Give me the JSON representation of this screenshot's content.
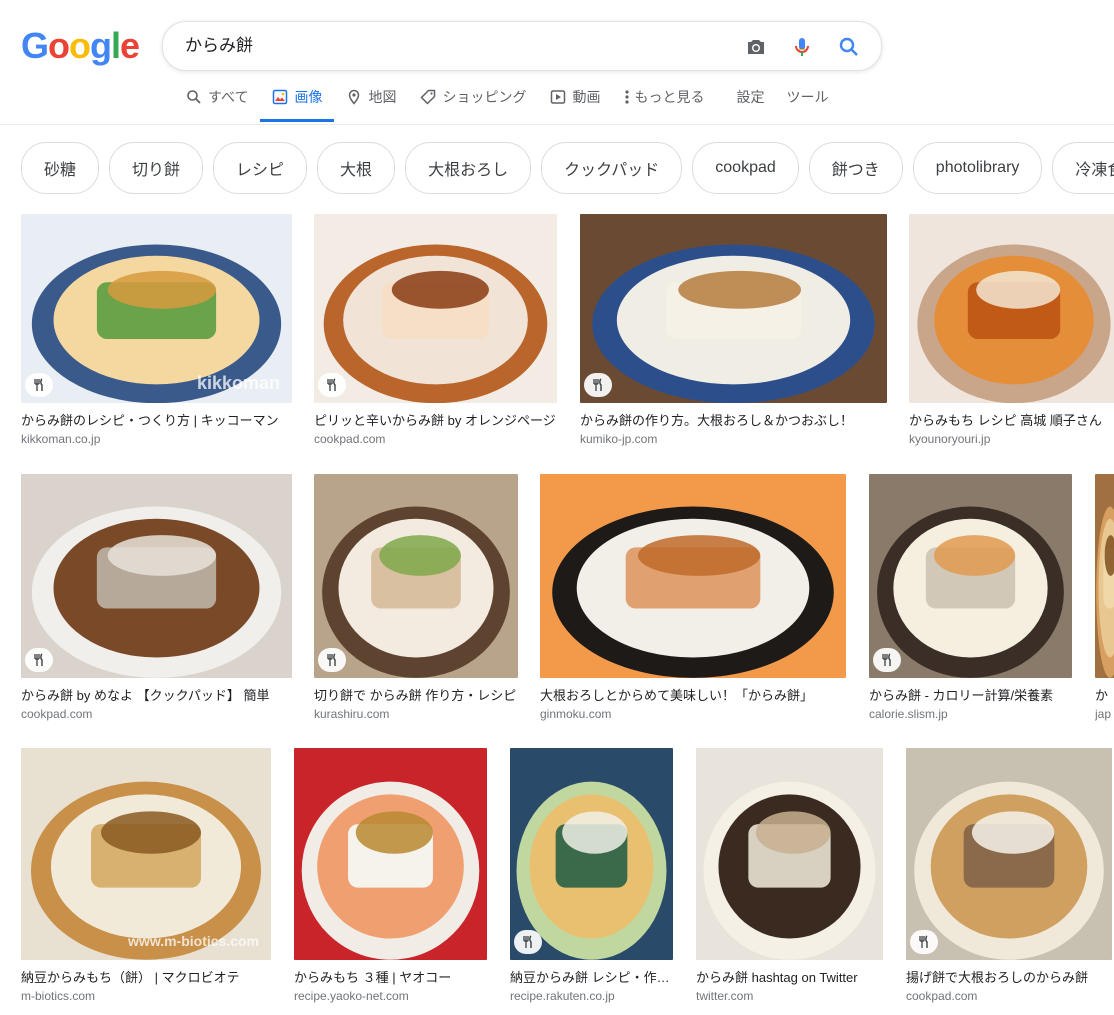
{
  "header": {
    "logo_letters": [
      {
        "ch": "G",
        "color": "#4285F4"
      },
      {
        "ch": "o",
        "color": "#EA4335"
      },
      {
        "ch": "o",
        "color": "#FBBC05"
      },
      {
        "ch": "g",
        "color": "#4285F4"
      },
      {
        "ch": "l",
        "color": "#34A853"
      },
      {
        "ch": "e",
        "color": "#EA4335"
      }
    ],
    "query": "からみ餅",
    "icons": [
      "camera-icon",
      "microphone-icon",
      "search-icon"
    ]
  },
  "tabs": [
    {
      "label": "すべて",
      "icon": "search-icon",
      "active": false
    },
    {
      "label": "画像",
      "icon": "image-icon",
      "active": true
    },
    {
      "label": "地図",
      "icon": "map-pin-icon",
      "active": false
    },
    {
      "label": "ショッピング",
      "icon": "tag-icon",
      "active": false
    },
    {
      "label": "動画",
      "icon": "play-icon",
      "active": false
    },
    {
      "label": "もっと見る",
      "icon": "more-vert-icon",
      "active": false
    },
    {
      "label": "設定",
      "icon": "",
      "active": false
    },
    {
      "label": "ツール",
      "icon": "",
      "active": false
    }
  ],
  "chips": [
    "砂糖",
    "切り餅",
    "レシピ",
    "大根",
    "大根おろし",
    "クックパッド",
    "cookpad",
    "餅つき",
    "photolibrary",
    "冷凍食品"
  ],
  "results": [
    {
      "caption": "からみ餅のレシピ・つくり方 | キッコーマン",
      "domain": "kikkoman.co.jp",
      "recipe": true,
      "watermark": "kikkoman"
    },
    {
      "caption": "ピリッと辛いからみ餅 by オレンジページ",
      "domain": "cookpad.com",
      "recipe": true,
      "watermark": ""
    },
    {
      "caption": "からみ餅の作り方。大根おろし＆かつおぶし！",
      "domain": "kumiko-jp.com",
      "recipe": true,
      "watermark": ""
    },
    {
      "caption": "からみもち レシピ 高城 順子さん",
      "domain": "kyounoryouri.jp",
      "recipe": false,
      "watermark": ""
    },
    {
      "caption": "からみ餅 by めなよ 【クックパッド】 簡単",
      "domain": "cookpad.com",
      "recipe": true,
      "watermark": ""
    },
    {
      "caption": "切り餅で からみ餅 作り方・レシピ",
      "domain": "kurashiru.com",
      "recipe": true,
      "watermark": ""
    },
    {
      "caption": "大根おろしとからめて美味しい！「からみ餅」",
      "domain": "ginmoku.com",
      "recipe": false,
      "watermark": ""
    },
    {
      "caption": "からみ餅 - カロリー計算/栄養素",
      "domain": "calorie.slism.jp",
      "recipe": true,
      "watermark": ""
    },
    {
      "caption": "か",
      "domain": "jap",
      "recipe": false,
      "watermark": ""
    },
    {
      "caption": "納豆からみもち（餅） | マクロビオテ",
      "domain": "m-biotics.com",
      "recipe": false,
      "watermark": "www.m-biotics.com"
    },
    {
      "caption": "からみもち ３種 | ヤオコー",
      "domain": "recipe.yaoko-net.com",
      "recipe": false,
      "watermark": ""
    },
    {
      "caption": "納豆からみ餅 レシピ・作り方",
      "domain": "recipe.rakuten.co.jp",
      "recipe": true,
      "watermark": ""
    },
    {
      "caption": "からみ餅 hashtag on Twitter",
      "domain": "twitter.com",
      "recipe": false,
      "watermark": ""
    },
    {
      "caption": "揚げ餅で大根おろしのからみ餅",
      "domain": "cookpad.com",
      "recipe": true,
      "watermark": ""
    }
  ],
  "colors": {
    "accent": "#1a73e8",
    "tab_text": "#5f6368",
    "domain_text": "#70757a"
  }
}
